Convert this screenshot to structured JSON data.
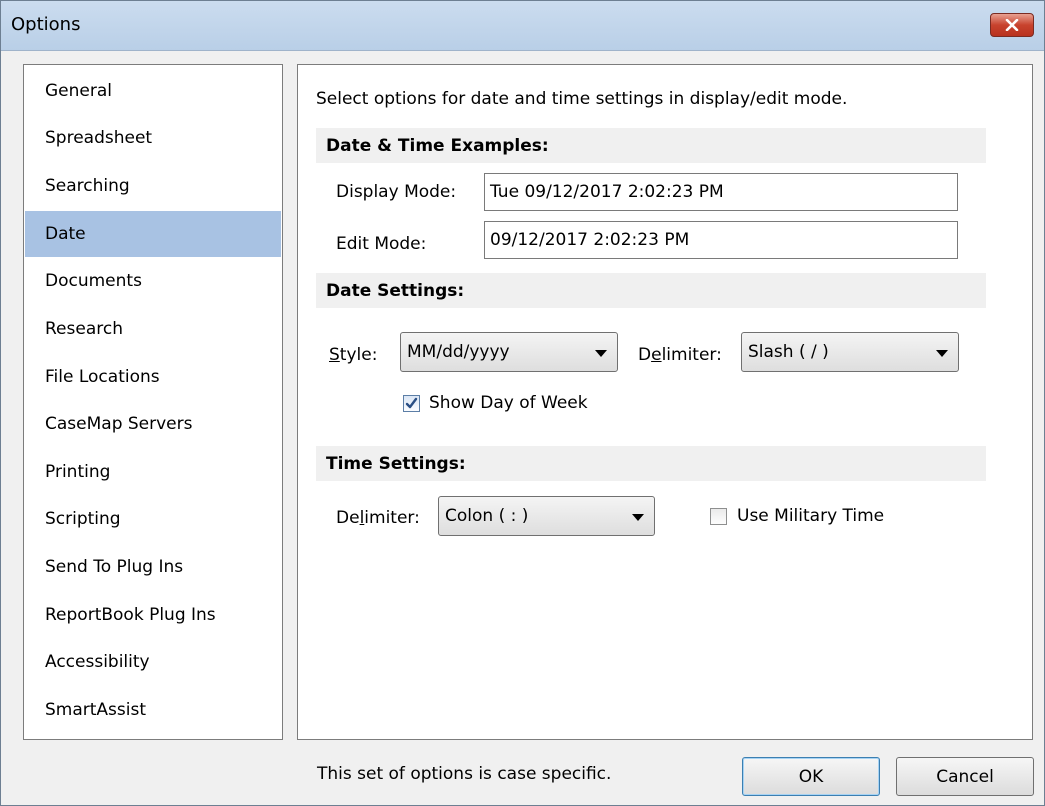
{
  "window": {
    "title": "Options"
  },
  "sidebar": {
    "items": [
      {
        "label": "General"
      },
      {
        "label": "Spreadsheet"
      },
      {
        "label": "Searching"
      },
      {
        "label": "Date",
        "selected": true
      },
      {
        "label": "Documents"
      },
      {
        "label": "Research"
      },
      {
        "label": "File Locations"
      },
      {
        "label": "CaseMap Servers"
      },
      {
        "label": "Printing"
      },
      {
        "label": "Scripting"
      },
      {
        "label": "Send To Plug Ins"
      },
      {
        "label": "ReportBook Plug Ins"
      },
      {
        "label": "Accessibility"
      },
      {
        "label": "SmartAssist"
      }
    ]
  },
  "panel": {
    "intro": "Select options for date and time settings in display/edit mode.",
    "examples": {
      "heading": "Date & Time Examples:",
      "display_label": "Display Mode:",
      "display_value": "Tue 09/12/2017 2:02:23 PM",
      "edit_label": "Edit Mode:",
      "edit_value": "09/12/2017 2:02:23 PM"
    },
    "date_settings": {
      "heading": "Date Settings:",
      "style_label_u": "S",
      "style_label_rest": "tyle:",
      "style_value": "MM/dd/yyyy",
      "delimiter_label_pre": "D",
      "delimiter_label_u": "e",
      "delimiter_label_rest": "limiter:",
      "delimiter_value": "Slash ( / )",
      "show_day_label": "Show Day of Week",
      "show_day_checked": true
    },
    "time_settings": {
      "heading": "Time Settings:",
      "delimiter_label_pre": "De",
      "delimiter_label_u": "l",
      "delimiter_label_rest": "imiter:",
      "delimiter_value": "Colon ( : )",
      "military_label": "Use Military Time",
      "military_checked": false
    }
  },
  "footer": {
    "status": "This set of options is case specific.",
    "ok_label": "OK",
    "cancel_label": "Cancel"
  },
  "icons": {
    "close": "close-icon",
    "dropdown": "chevron-down-icon",
    "check": "checkmark-icon"
  },
  "colors": {
    "selection": "#a8c2e3",
    "titlebar": "#c3d6ec",
    "close_button": "#c8432e"
  }
}
